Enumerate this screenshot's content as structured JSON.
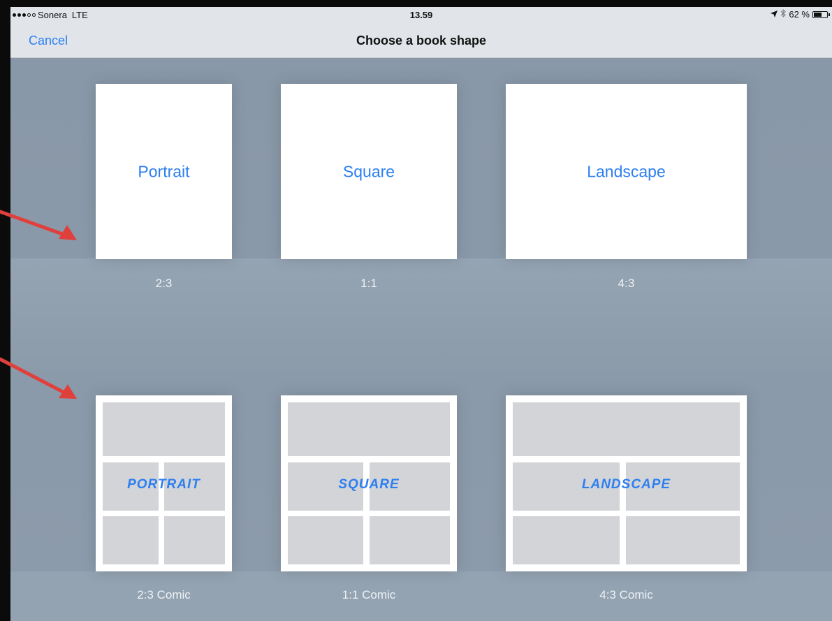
{
  "status_bar": {
    "carrier": "Sonera",
    "network": "LTE",
    "time": "13.59",
    "battery_percent": "62 %",
    "battery_level": 0.62
  },
  "nav": {
    "cancel_label": "Cancel",
    "title": "Choose a book shape"
  },
  "shapes": [
    {
      "label": "Portrait",
      "ratio": "2:3"
    },
    {
      "label": "Square",
      "ratio": "1:1"
    },
    {
      "label": "Landscape",
      "ratio": "4:3"
    }
  ],
  "comic_shapes": [
    {
      "label": "PORTRAIT",
      "ratio": "2:3 Comic"
    },
    {
      "label": "SQUARE",
      "ratio": "1:1 Comic"
    },
    {
      "label": "LANDSCAPE",
      "ratio": "4:3 Comic"
    }
  ],
  "colors": {
    "accent": "#2d7ff0",
    "background": "#8898a8",
    "arrow": "#e0403c"
  },
  "icons": [
    "signal-dots-icon",
    "location-arrow-icon",
    "bluetooth-icon",
    "battery-icon"
  ]
}
